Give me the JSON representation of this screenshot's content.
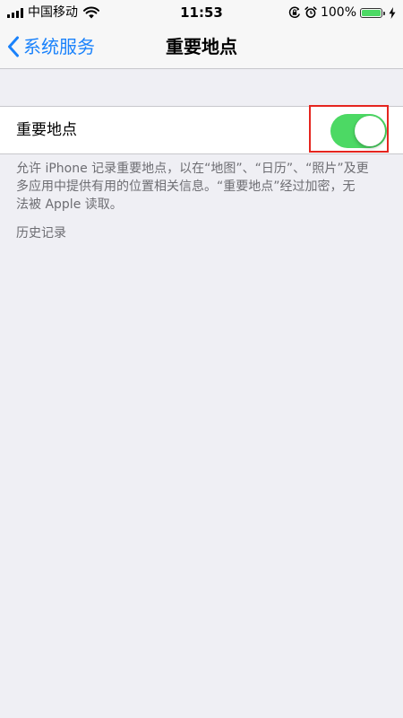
{
  "status_bar": {
    "carrier": "中国移动",
    "time": "11:53",
    "battery_percent": "100%"
  },
  "nav": {
    "back_label": "系统服务",
    "title": "重要地点"
  },
  "setting": {
    "label": "重要地点",
    "enabled": true
  },
  "footer": {
    "lines": [
      "允许 iPhone 记录重要地点，以在“地图”、“日历”、“照片”及更",
      "多应用中提供有用的位置相关信息。“重要地点”经过加密，无",
      "法被 Apple 读取。"
    ]
  },
  "history_label": "历史记录",
  "colors": {
    "accent": "#1a82fb",
    "toggle_on": "#4cd964",
    "highlight": "#e5251f",
    "background": "#efeff4"
  }
}
